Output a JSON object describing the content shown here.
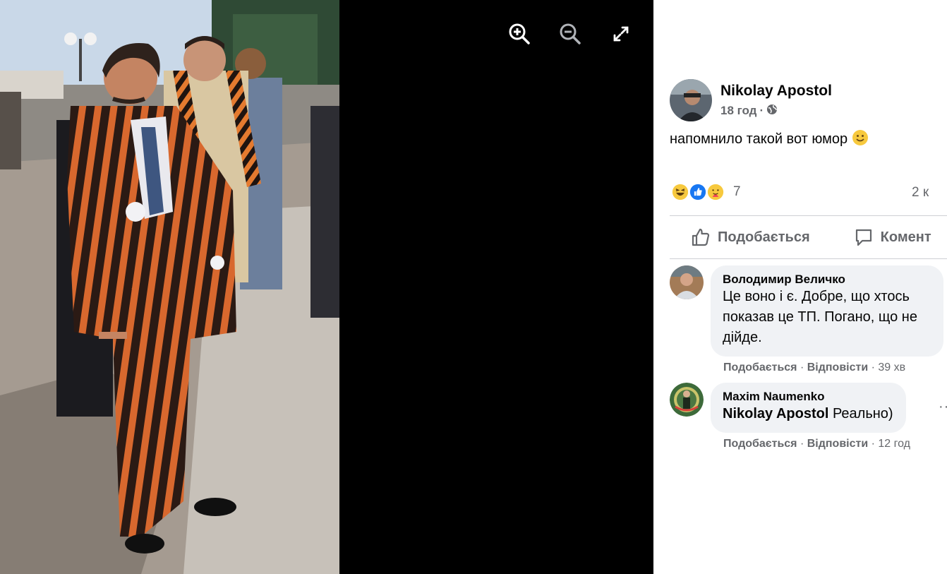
{
  "viewer": {
    "zoom_in_icon": "zoom-in-icon",
    "zoom_out_icon": "zoom-out-icon",
    "fullscreen_icon": "fullscreen-icon"
  },
  "post": {
    "author": "Nikolay Apostol",
    "time": "18 год",
    "separator": "·",
    "privacy_icon": "globe-icon",
    "text": "напомнило такой вот юмор",
    "reaction_icons": [
      "haha",
      "like",
      "care"
    ],
    "reaction_count": "7",
    "comment_count": "2 к",
    "like_label": "Подобається",
    "comment_label": "Комент"
  },
  "comments": [
    {
      "author": "Володимир Величко",
      "text_lines": [
        "Це воно і є. Добре, що хтось",
        "показав це ТП. Погано, що не",
        "дійде."
      ],
      "like": "Подобається",
      "reply": "Відповісти",
      "time": "39 хв"
    },
    {
      "author": "Maxim Naumenko",
      "mention": "Nikolay Apostol",
      "text": "Реально)",
      "like": "Подобається",
      "reply": "Відповісти",
      "time": "12 год"
    }
  ],
  "colors": {
    "background": "#000000",
    "text": "#050505",
    "secondary": "#65676b",
    "bubble": "#f0f2f5",
    "like_blue": "#1877f2"
  }
}
